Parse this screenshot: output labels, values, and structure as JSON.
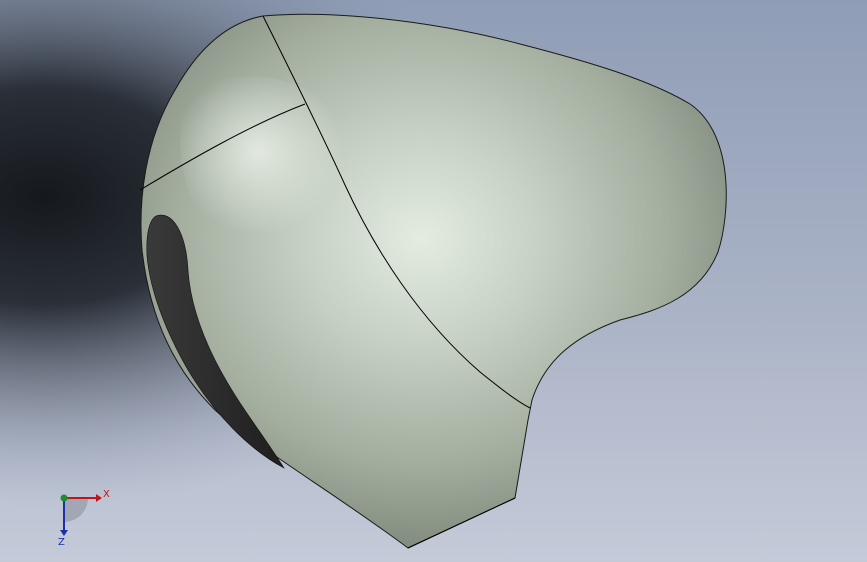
{
  "colors": {
    "background_top": "#8d9cb5",
    "background_bottom": "#c3c9d7",
    "background_shadow": "#1b1f24",
    "part_base": "#a9b3a4",
    "part_highlight": "#e6eee4",
    "part_shadow": "#7f8a7c",
    "edge_line": "#000000",
    "cavity": "#2a2a2a",
    "axis_x": "#c0161b",
    "axis_y": "#1e8e2a",
    "axis_z": "#1d2fa6"
  },
  "triad": {
    "x_label": "X",
    "z_label": "Z"
  }
}
